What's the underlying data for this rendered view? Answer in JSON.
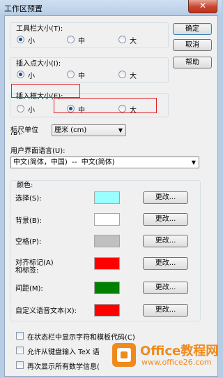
{
  "window": {
    "title": "工作区预置",
    "close_glyph": "✕"
  },
  "toolbar_size": {
    "label": "工具栏大小(T):",
    "options": [
      "小",
      "中",
      "大"
    ],
    "selected": "小"
  },
  "insertion_point_size": {
    "label": "插入点大小(I):",
    "options": [
      "小",
      "中",
      "大"
    ],
    "selected": "小"
  },
  "insertion_box_size": {
    "label": "插入框大小(E):",
    "options": [
      "小",
      "中",
      "大"
    ],
    "selected": "中"
  },
  "buttons": {
    "ok": "确定",
    "cancel": "取消",
    "help": "帮助"
  },
  "ruler_unit": {
    "label_line1": "标尺单位",
    "label_line2": "(R):",
    "value": "厘米 (cm)"
  },
  "ui_language": {
    "label": "用户界面语言(U):",
    "value": "中文(简体，中国)  --  中文(简体)"
  },
  "colors": {
    "group_label": "颜色:",
    "change_label": "更改...",
    "items": [
      {
        "label": "选择(S):",
        "color": "#99ffff"
      },
      {
        "label": "背景(B):",
        "color": "#ffffff"
      },
      {
        "label": "空格(P):",
        "color": "#c0c0c0"
      },
      {
        "label": "对齐标记(A)",
        "label2": "和标签:",
        "color": "#ff0000"
      },
      {
        "label": "间距(M):",
        "color": "#008000"
      },
      {
        "label": "自定义语音文本(X):",
        "color": "#ff0000"
      }
    ]
  },
  "checkboxes": [
    {
      "label": "在状态栏中显示字符和模板代码(C)",
      "checked": false
    },
    {
      "label": "允许从键盘输入 TeX 语",
      "checked": false
    },
    {
      "label": "再次显示所有数学信息(",
      "checked": false
    }
  ],
  "watermark": {
    "brand": "Office教程网",
    "url": "www.office26.com"
  },
  "accent_colors": {
    "highlight_box": "#e02020",
    "watermark_orange": "#f08a1c"
  }
}
